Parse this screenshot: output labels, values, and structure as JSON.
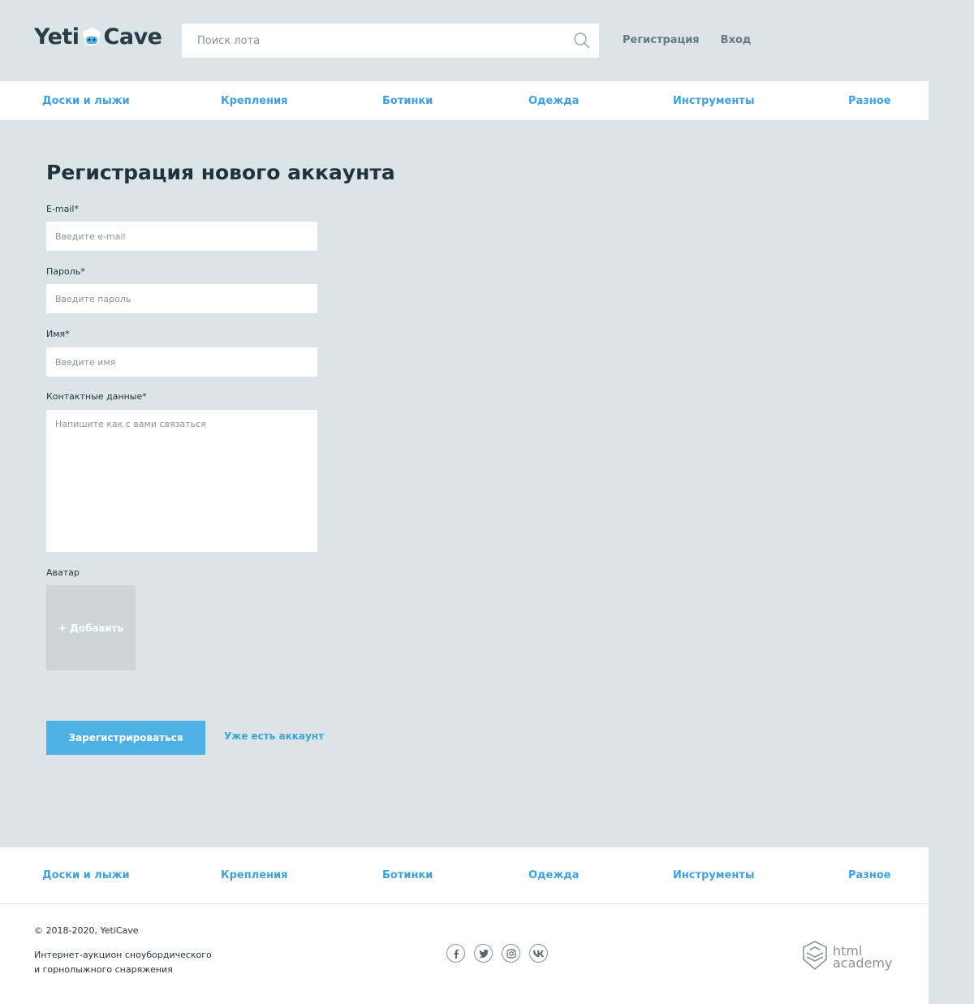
{
  "header": {
    "logo_left": "Yeti",
    "logo_right": "Cave",
    "search_placeholder": "Поиск лота",
    "user_menu": [
      "Регистрация",
      "Вход"
    ]
  },
  "nav": {
    "items": [
      "Доски и лыжи",
      "Крепления",
      "Ботинки",
      "Одежда",
      "Инструменты",
      "Разное"
    ]
  },
  "form": {
    "title": "Регистрация нового аккаунта",
    "email_label": "E-mail*",
    "email_placeholder": "Введите e-mail",
    "password_label": "Пароль*",
    "password_placeholder": "Введите пароль",
    "name_label": "Имя*",
    "name_placeholder": "Введите имя",
    "contacts_label": "Контактные данные*",
    "contacts_placeholder": "Напишите как с вами связаться",
    "avatar_label": "Аватар",
    "avatar_add": "+ Добавить",
    "submit": "Зарегистрироваться",
    "have_account": "Уже есть аккаунт"
  },
  "footer": {
    "copyright": "© 2018-2020, YetiCave",
    "about_line1": "Интернет-аукцион сноубордического",
    "about_line2": "и горнолыжного снаряжения",
    "academy_line1": "html",
    "academy_line2": "academy"
  },
  "colors": {
    "background": "#dbe5e8",
    "accent": "#3fa2d9",
    "button": "#4eb0e5",
    "avatar_box": "#ccd5d8"
  }
}
